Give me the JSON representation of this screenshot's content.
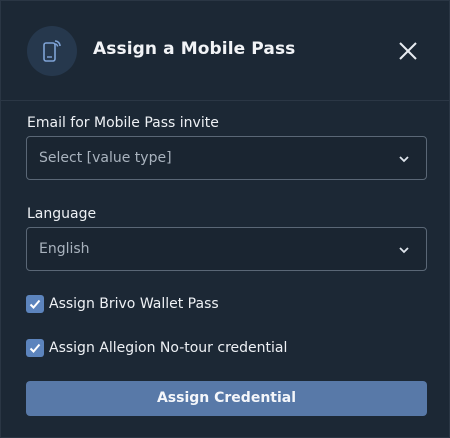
{
  "header": {
    "title": "Assign a Mobile Pass",
    "icon": "mobile-pass-icon",
    "close_icon": "close-icon"
  },
  "email_field": {
    "label": "Email for Mobile Pass invite",
    "value": "Select [value type]"
  },
  "language_field": {
    "label": "Language",
    "value": "English"
  },
  "checkboxes": [
    {
      "label": "Assign Brivo Wallet Pass",
      "checked": true
    },
    {
      "label": "Assign Allegion No-tour credential",
      "checked": true
    }
  ],
  "submit": {
    "label": "Assign Credential"
  },
  "colors": {
    "background": "#1c2835",
    "accent": "#5879a8",
    "checkbox": "#5c84bd"
  }
}
